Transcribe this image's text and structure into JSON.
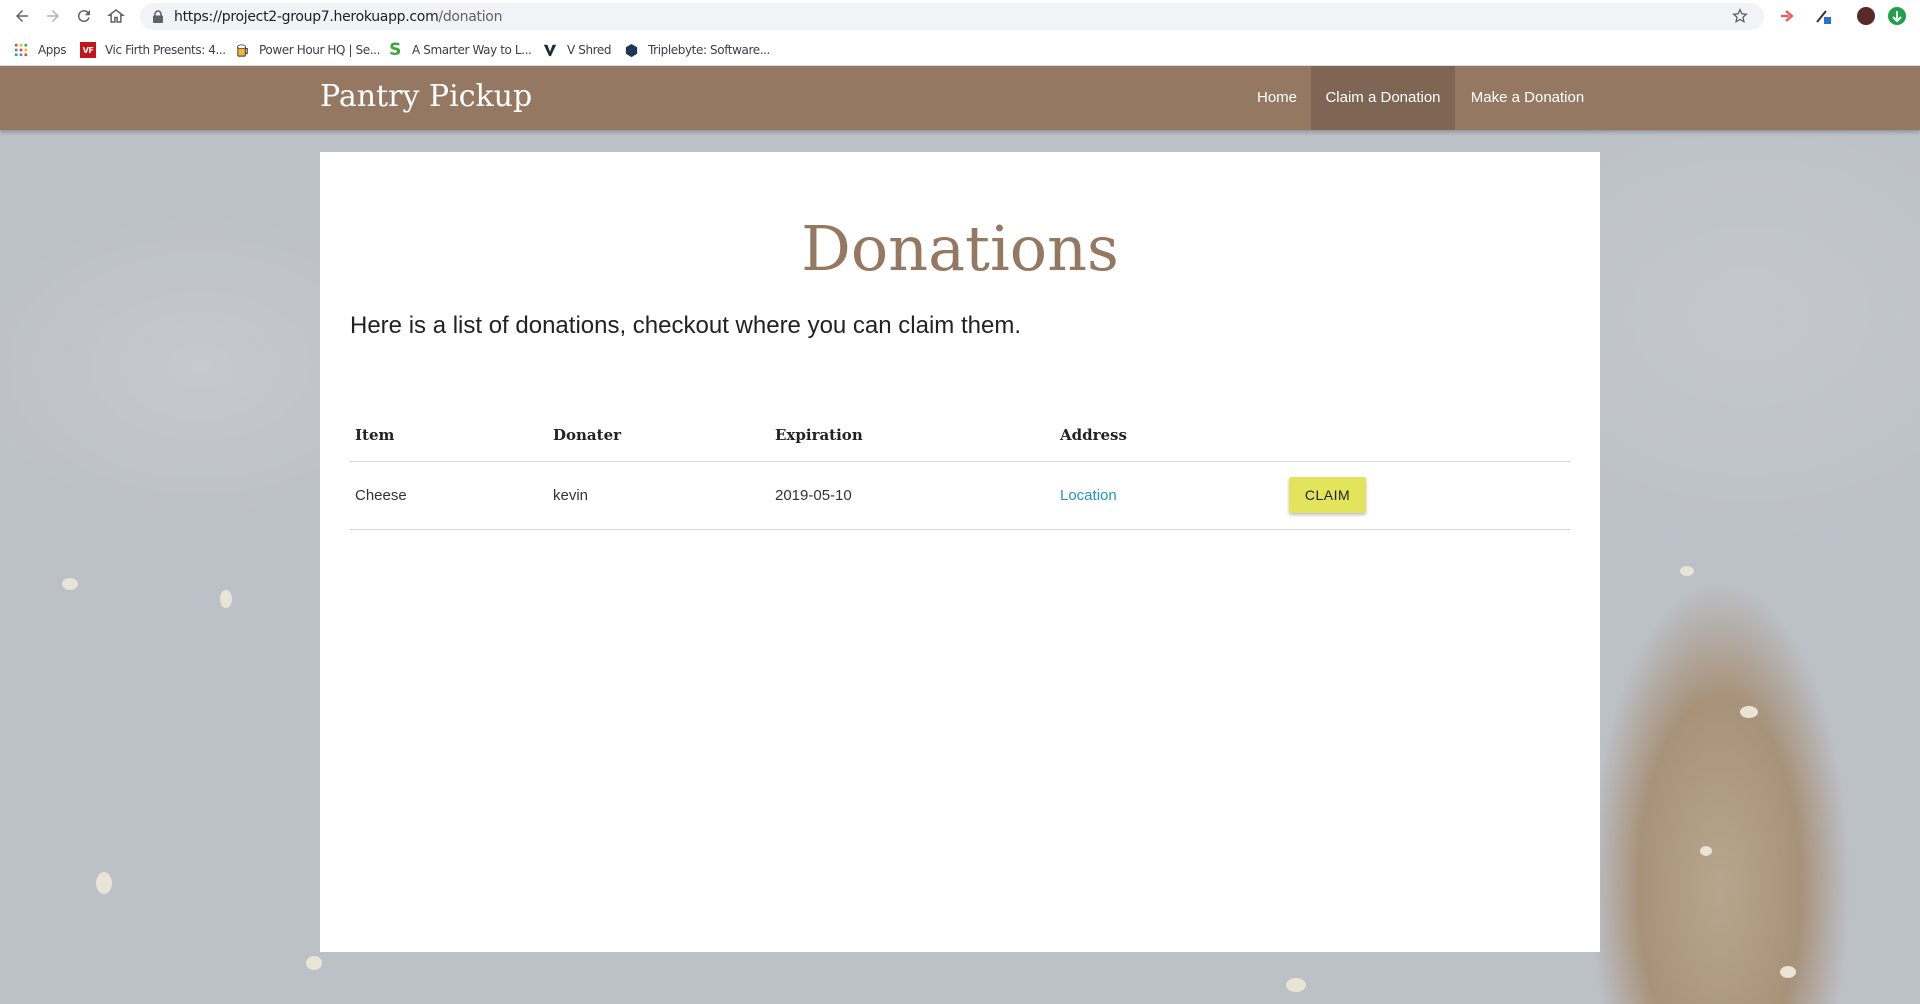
{
  "browser": {
    "url_host": "https://project2-group7.herokuapp.com",
    "url_path": "/donation",
    "bookmarks": [
      {
        "label": "Apps",
        "icon": "apps-grid-icon"
      },
      {
        "label": "Vic Firth Presents: 4...",
        "icon": "vic-firth-icon"
      },
      {
        "label": "Power Hour HQ | Se...",
        "icon": "beer-mug-icon"
      },
      {
        "label": "A Smarter Way to L...",
        "icon": "smarter-way-s-icon"
      },
      {
        "label": "V Shred",
        "icon": "vshred-icon"
      },
      {
        "label": "Triplebyte: Software...",
        "icon": "triplebyte-icon"
      }
    ]
  },
  "site": {
    "brand": "Pantry Pickup",
    "nav": [
      {
        "label": "Home",
        "active": false
      },
      {
        "label": "Claim a Donation",
        "active": true
      },
      {
        "label": "Make a Donation",
        "active": false
      }
    ]
  },
  "main": {
    "title": "Donations",
    "intro": "Here is a list of donations, checkout where you can claim them.",
    "table": {
      "headers": [
        "Item",
        "Donater",
        "Expiration",
        "Address"
      ],
      "rows": [
        {
          "item": "Cheese",
          "donater": "kevin",
          "expiration": "2019-05-10",
          "address": "Location",
          "action": "CLAIM"
        }
      ]
    }
  },
  "colors": {
    "nav_bg": "#957862",
    "nav_active": "#7e6554",
    "title": "#957862",
    "link": "#2196b6",
    "claim_button": "#e4e35c"
  }
}
